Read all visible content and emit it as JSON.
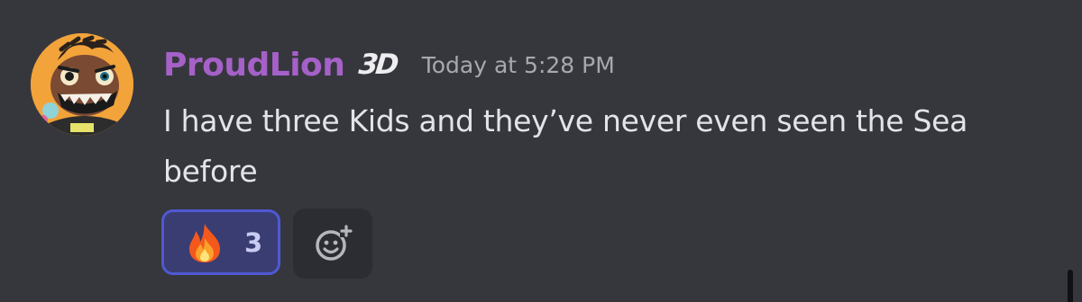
{
  "message": {
    "username": "ProudLion",
    "tag": "3D",
    "timestamp": "Today at 5:28 PM",
    "content": "I have three Kids and they’ve never even seen the Sea before",
    "avatar_icon": "cartoon-lion-avatar-icon"
  },
  "reactions": [
    {
      "emoji_icon": "fire-emoji-icon",
      "count": "3",
      "reacted_by_me": true
    }
  ],
  "add_reaction_icon": "smile-plus-icon",
  "colors": {
    "background": "#36373d",
    "username": "#a561c8",
    "timestamp": "#a7a9ae",
    "content": "#e3e4e8",
    "reaction_active_bg": "#3a3d72",
    "reaction_active_border": "#5058d3",
    "add_reaction_bg": "#2c2d33"
  }
}
